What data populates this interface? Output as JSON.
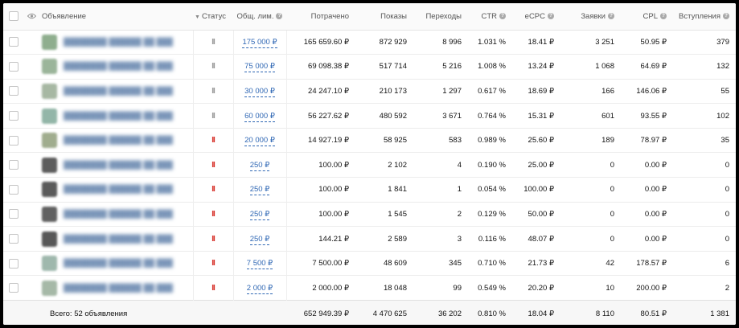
{
  "header": {
    "ad_label": "Объявление",
    "status_label": "Статус",
    "limit_label": "Общ. лим.",
    "spent_label": "Потрачено",
    "impressions_label": "Показы",
    "clicks_label": "Переходы",
    "ctr_label": "CTR",
    "ecpc_label": "eCPC",
    "leads_label": "Заявки",
    "cpl_label": "CPL",
    "joins_label": "Вступления"
  },
  "rows": [
    {
      "thumb": "#8fae8e",
      "status": "grey",
      "limit": "175 000 ₽",
      "spent": "165 659.60 ₽",
      "impressions": "872 929",
      "clicks": "8 996",
      "ctr": "1.031 %",
      "ecpc": "18.41 ₽",
      "leads": "3 251",
      "cpl": "50.95 ₽",
      "joins": "379"
    },
    {
      "thumb": "#9bb59a",
      "status": "grey",
      "limit": "75 000 ₽",
      "spent": "69 098.38 ₽",
      "impressions": "517 714",
      "clicks": "5 216",
      "ctr": "1.008 %",
      "ecpc": "13.24 ₽",
      "leads": "1 068",
      "cpl": "64.69 ₽",
      "joins": "132"
    },
    {
      "thumb": "#a7b8a3",
      "status": "grey",
      "limit": "30 000 ₽",
      "spent": "24 247.10 ₽",
      "impressions": "210 173",
      "clicks": "1 297",
      "ctr": "0.617 %",
      "ecpc": "18.69 ₽",
      "leads": "166",
      "cpl": "146.06 ₽",
      "joins": "55"
    },
    {
      "thumb": "#93b6a8",
      "status": "grey",
      "limit": "60 000 ₽",
      "spent": "56 227.62 ₽",
      "impressions": "480 592",
      "clicks": "3 671",
      "ctr": "0.764 %",
      "ecpc": "15.31 ₽",
      "leads": "601",
      "cpl": "93.55 ₽",
      "joins": "102"
    },
    {
      "thumb": "#a0ad8e",
      "status": "red",
      "limit": "20 000 ₽",
      "spent": "14 927.19 ₽",
      "impressions": "58 925",
      "clicks": "583",
      "ctr": "0.989 %",
      "ecpc": "25.60 ₽",
      "leads": "189",
      "cpl": "78.97 ₽",
      "joins": "35"
    },
    {
      "thumb": "#5d5d5d",
      "status": "red",
      "limit": "250 ₽",
      "spent": "100.00 ₽",
      "impressions": "2 102",
      "clicks": "4",
      "ctr": "0.190 %",
      "ecpc": "25.00 ₽",
      "leads": "0",
      "cpl": "0.00 ₽",
      "joins": "0"
    },
    {
      "thumb": "#5a5a5a",
      "status": "red",
      "limit": "250 ₽",
      "spent": "100.00 ₽",
      "impressions": "1 841",
      "clicks": "1",
      "ctr": "0.054 %",
      "ecpc": "100.00 ₽",
      "leads": "0",
      "cpl": "0.00 ₽",
      "joins": "0"
    },
    {
      "thumb": "#616161",
      "status": "red",
      "limit": "250 ₽",
      "spent": "100.00 ₽",
      "impressions": "1 545",
      "clicks": "2",
      "ctr": "0.129 %",
      "ecpc": "50.00 ₽",
      "leads": "0",
      "cpl": "0.00 ₽",
      "joins": "0"
    },
    {
      "thumb": "#585858",
      "status": "red",
      "limit": "250 ₽",
      "spent": "144.21 ₽",
      "impressions": "2 589",
      "clicks": "3",
      "ctr": "0.116 %",
      "ecpc": "48.07 ₽",
      "leads": "0",
      "cpl": "0.00 ₽",
      "joins": "0"
    },
    {
      "thumb": "#9fb8ad",
      "status": "red",
      "limit": "7 500 ₽",
      "spent": "7 500.00 ₽",
      "impressions": "48 609",
      "clicks": "345",
      "ctr": "0.710 %",
      "ecpc": "21.73 ₽",
      "leads": "42",
      "cpl": "178.57 ₽",
      "joins": "6"
    },
    {
      "thumb": "#a6b9a7",
      "status": "red",
      "limit": "2 000 ₽",
      "spent": "2 000.00 ₽",
      "impressions": "18 048",
      "clicks": "99",
      "ctr": "0.549 %",
      "ecpc": "20.20 ₽",
      "leads": "10",
      "cpl": "200.00 ₽",
      "joins": "2"
    }
  ],
  "totals": {
    "label": "Всего: 52 объявления",
    "spent": "652 949.39 ₽",
    "impressions": "4 470 625",
    "clicks": "36 202",
    "ctr": "0.810 %",
    "ecpc": "18.04 ₽",
    "leads": "8 110",
    "cpl": "80.51 ₽",
    "joins": "1 381"
  },
  "colors": {
    "status_active_grey": "#9a9a9a",
    "status_paused_red": "#d7322b",
    "link_blue": "#2f67b4"
  },
  "icons": {
    "visibility": "eye-icon",
    "info": "info-icon",
    "sort": "sort-down-icon",
    "pause": "pause-icon"
  }
}
